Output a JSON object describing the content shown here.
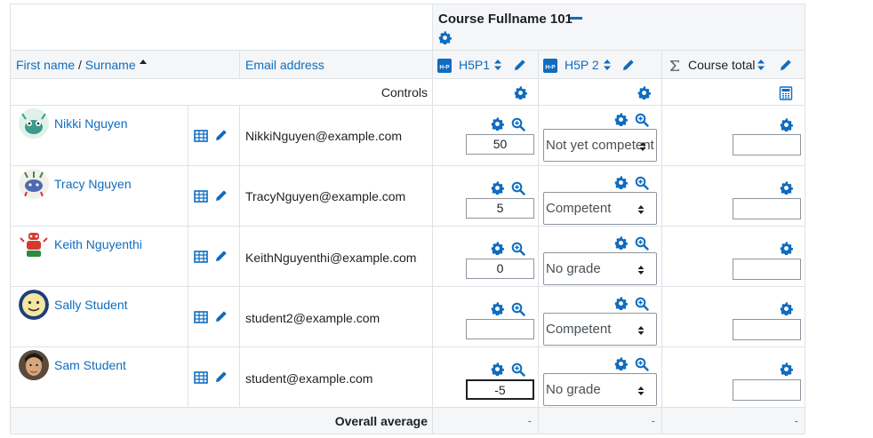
{
  "course": {
    "fullname": "Course Fullname 101"
  },
  "header": {
    "first_name": "First name",
    "separator": " / ",
    "surname": "Surname",
    "email": "Email address",
    "controls": "Controls",
    "overall_average": "Overall average"
  },
  "items": [
    {
      "name": "H5P1",
      "badge": "H-P"
    },
    {
      "name": "H5P 2",
      "badge": "H-P"
    },
    {
      "name": "Course total"
    }
  ],
  "students": [
    {
      "name": "Nikki Nguyen",
      "email": "NikkiNguyen@example.com",
      "h5p1": "50",
      "h5p2": "Not yet competent"
    },
    {
      "name": "Tracy Nguyen",
      "email": "TracyNguyen@example.com",
      "h5p1": "5",
      "h5p2": "Competent"
    },
    {
      "name": "Keith Nguyenthi",
      "email": "KeithNguyenthi@example.com",
      "h5p1": "0",
      "h5p2": "No grade"
    },
    {
      "name": "Sally Student",
      "email": "student2@example.com",
      "h5p1": "",
      "h5p2": "Competent"
    },
    {
      "name": "Sam Student",
      "email": "student@example.com",
      "h5p1": "-5",
      "h5p2": "No grade"
    }
  ],
  "averages": {
    "h5p1": "-",
    "h5p2": "-",
    "total": "-"
  },
  "colors": {
    "link": "#0f6cbf",
    "border": "#dee2e6",
    "header_bg": "#f5f6f7"
  }
}
